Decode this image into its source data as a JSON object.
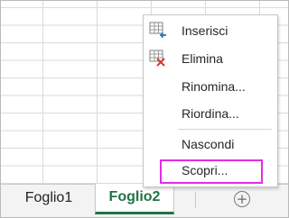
{
  "sheet_tabs": [
    {
      "label": "Foglio1",
      "active": false
    },
    {
      "label": "Foglio2",
      "active": true
    }
  ],
  "add_sheet_icon": "plus-circle-icon",
  "context_menu": {
    "items": [
      {
        "label": "Inserisci",
        "icon": "insert-sheet-icon"
      },
      {
        "label": "Elimina",
        "icon": "delete-sheet-icon"
      },
      {
        "label": "Rinomina..."
      },
      {
        "label": "Riordina..."
      },
      {
        "label": "Nascondi"
      },
      {
        "label": "Scopri...",
        "highlighted": true
      }
    ]
  },
  "colors": {
    "active_tab": "#217346",
    "highlight": "#e22ce8",
    "delete_x": "#d9342b",
    "insert_arrow": "#2a6fb5"
  }
}
